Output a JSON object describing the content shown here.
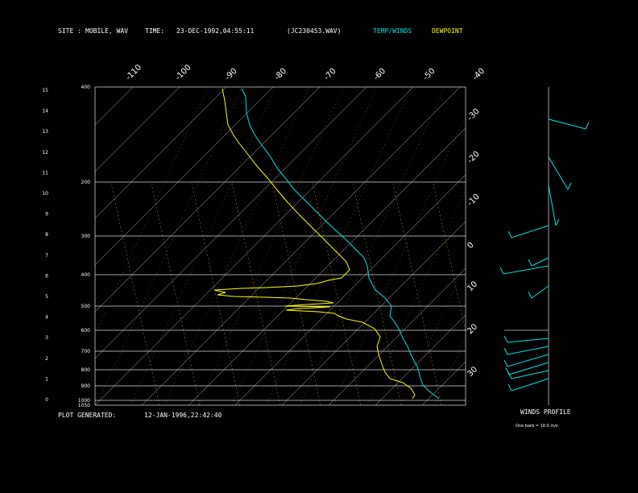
{
  "header": {
    "site_label": "SITE :",
    "site_value": "MOBILE, WAV",
    "time_label": "TIME:",
    "time_value": "23-DEC-1992,04:55:11",
    "file_value": "(JC230453.WAV)",
    "temp_winds_label": "TEMP/WINDS",
    "dewpoint_label": "DEWPOINT",
    "temp_color": "#00e5e5",
    "dewpoint_color": "#ffff00"
  },
  "footer": {
    "plot_generated_label": "PLOT GENERATED:",
    "plot_generated_value": "12-JAN-1996,22:42:40",
    "winds_profile_label": "WINDS PROFILE",
    "barb_note": "One barb = 10.0 m/s"
  },
  "chart_data": {
    "type": "line",
    "pressure_ticks": [
      "400",
      "200",
      "300",
      "400",
      "500",
      "600",
      "700",
      "800",
      "900",
      "1000",
      "1050"
    ],
    "height_ticks": [
      "15",
      "14",
      "13",
      "12",
      "11",
      "10",
      "9",
      "8",
      "7",
      "6",
      "5",
      "4",
      "3",
      "2",
      "1",
      "0"
    ],
    "top_temp_labels": [
      "-110",
      "-100",
      "-90",
      "-80",
      "-70",
      "-60",
      "-50",
      "-40"
    ],
    "right_temp_labels": [
      "-30",
      "-20",
      "-10",
      "0",
      "10",
      "20",
      "30"
    ],
    "series": [
      {
        "name": "TEMP/WINDS",
        "color": "#00e5e5",
        "points": [
          [
            300,
            110
          ],
          [
            305,
            120
          ],
          [
            306,
            140
          ],
          [
            310,
            155
          ],
          [
            315,
            165
          ],
          [
            318,
            170
          ],
          [
            325,
            180
          ],
          [
            336,
            195
          ],
          [
            345,
            210
          ],
          [
            355,
            222
          ],
          [
            365,
            235
          ],
          [
            378,
            248
          ],
          [
            392,
            262
          ],
          [
            405,
            275
          ],
          [
            418,
            287
          ],
          [
            430,
            298
          ],
          [
            442,
            310
          ],
          [
            452,
            320
          ],
          [
            456,
            330
          ],
          [
            458,
            345
          ],
          [
            466,
            360
          ],
          [
            478,
            370
          ],
          [
            486,
            380
          ],
          [
            484,
            392
          ],
          [
            490,
            400
          ],
          [
            496,
            410
          ],
          [
            500,
            420
          ],
          [
            506,
            430
          ],
          [
            510,
            440
          ],
          [
            514,
            448
          ],
          [
            518,
            455
          ],
          [
            520,
            462
          ],
          [
            522,
            470
          ],
          [
            525,
            478
          ],
          [
            532,
            485
          ],
          [
            545,
            495
          ]
        ]
      },
      {
        "name": "DEWPOINT",
        "color": "#ffff00",
        "points": [
          [
            276,
            110
          ],
          [
            279,
            125
          ],
          [
            281,
            140
          ],
          [
            283,
            155
          ],
          [
            290,
            168
          ],
          [
            297,
            178
          ],
          [
            305,
            188
          ],
          [
            318,
            205
          ],
          [
            333,
            222
          ],
          [
            345,
            237
          ],
          [
            356,
            250
          ],
          [
            370,
            265
          ],
          [
            383,
            278
          ],
          [
            397,
            292
          ],
          [
            410,
            305
          ],
          [
            420,
            315
          ],
          [
            430,
            325
          ],
          [
            434,
            335
          ],
          [
            424,
            345
          ],
          [
            408,
            348
          ],
          [
            393,
            352
          ],
          [
            370,
            355
          ],
          [
            330,
            357
          ],
          [
            300,
            358
          ],
          [
            266,
            360
          ],
          [
            280,
            363
          ],
          [
            270,
            366
          ],
          [
            290,
            368
          ],
          [
            330,
            369
          ],
          [
            360,
            370
          ],
          [
            380,
            372
          ],
          [
            405,
            374
          ],
          [
            414,
            376
          ],
          [
            380,
            378
          ],
          [
            353,
            380
          ],
          [
            410,
            381
          ],
          [
            370,
            383
          ],
          [
            355,
            385
          ],
          [
            395,
            387
          ],
          [
            415,
            389
          ],
          [
            420,
            392
          ],
          [
            430,
            396
          ],
          [
            450,
            400
          ],
          [
            465,
            408
          ],
          [
            472,
            418
          ],
          [
            468,
            430
          ],
          [
            470,
            440
          ],
          [
            474,
            452
          ],
          [
            478,
            462
          ],
          [
            484,
            470
          ],
          [
            500,
            475
          ],
          [
            510,
            482
          ],
          [
            515,
            490
          ],
          [
            512,
            495
          ]
        ]
      }
    ]
  }
}
